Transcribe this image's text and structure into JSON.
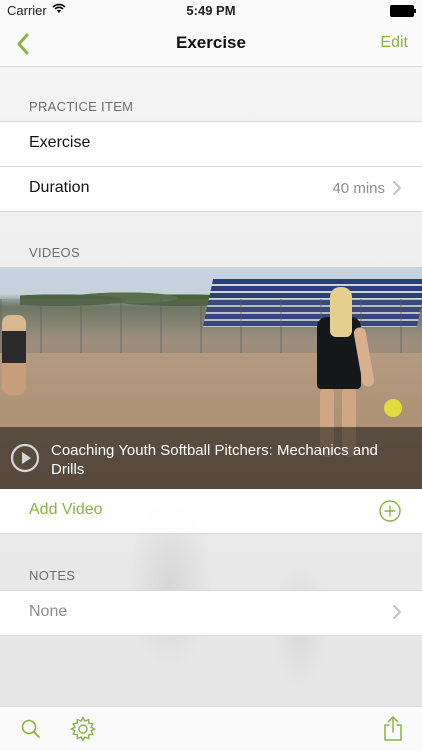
{
  "status_bar": {
    "carrier": "Carrier",
    "time": "5:49 PM",
    "wifi_icon": "wifi-icon",
    "battery_icon": "battery-icon"
  },
  "nav": {
    "title": "Exercise",
    "edit_label": "Edit",
    "back_icon": "chevron-left-icon"
  },
  "practice_item": {
    "header": "PRACTICE ITEM",
    "name": "Exercise",
    "duration_label": "Duration",
    "duration_value": "40 mins"
  },
  "videos": {
    "header": "VIDEOS",
    "items": [
      {
        "title": "Coaching Youth Softball Pitchers: Mechanics and Drills"
      }
    ],
    "add_label": "Add Video"
  },
  "notes": {
    "header": "NOTES",
    "value": "None"
  },
  "toolbar": {
    "search_icon": "search-icon",
    "settings_icon": "gear-icon",
    "share_icon": "share-icon"
  },
  "colors": {
    "accent": "#8cb342",
    "text_secondary": "#8e8e93",
    "section_header": "#6d6d72"
  }
}
